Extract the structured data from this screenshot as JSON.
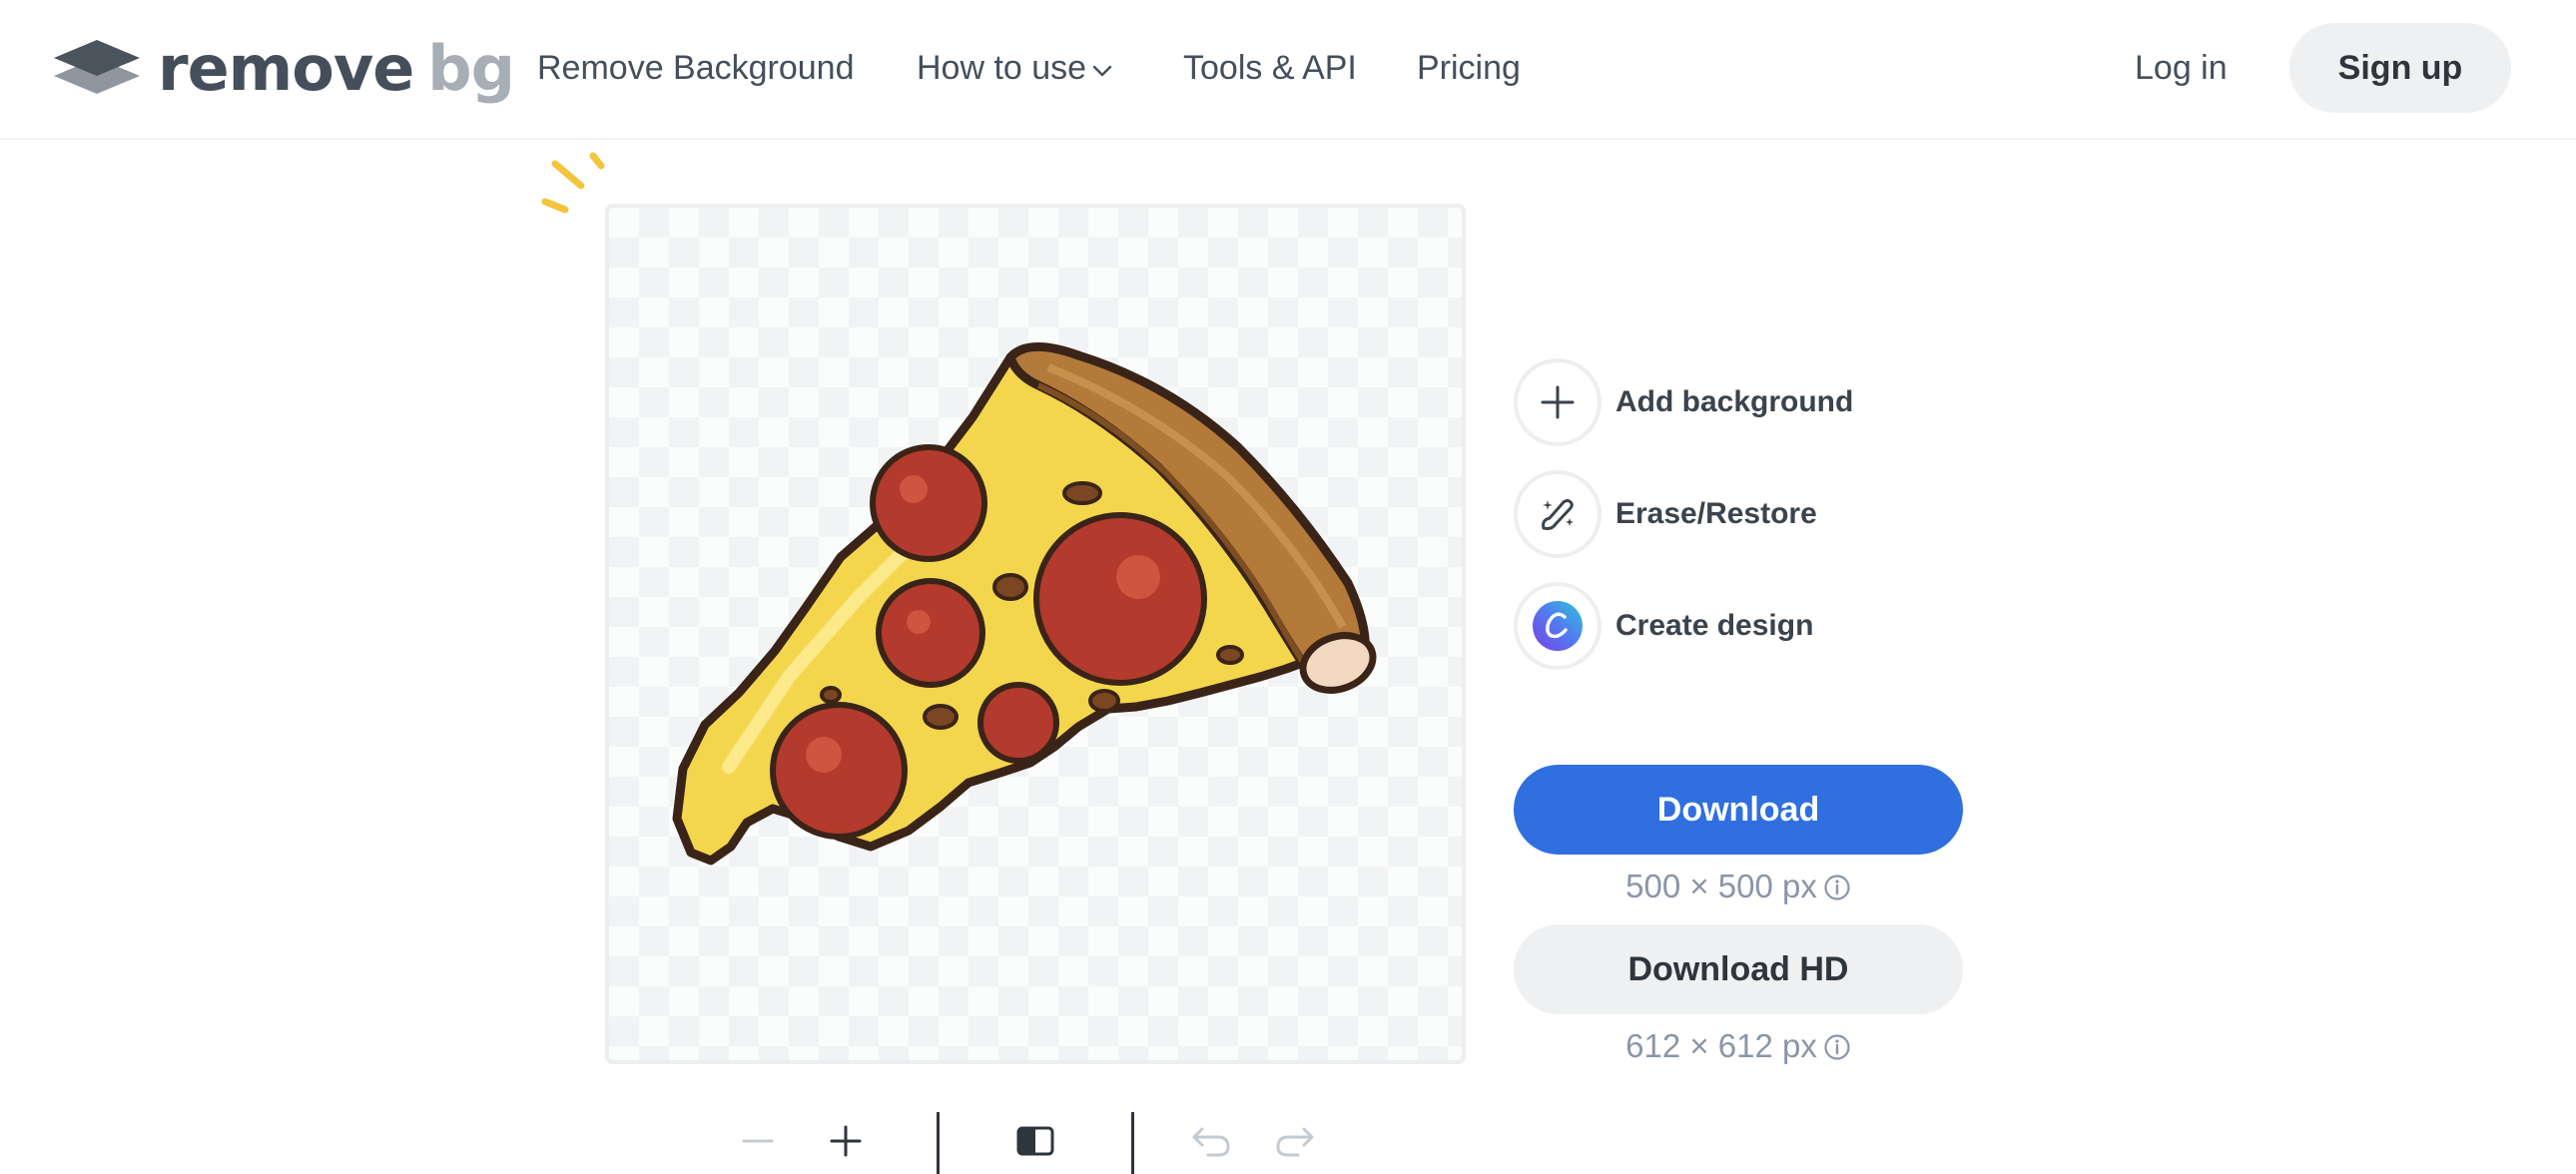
{
  "header": {
    "logo": {
      "word1": "remove",
      "word2": "bg",
      "icon": "layers-logo-icon"
    },
    "nav": [
      {
        "label": "Remove Background"
      },
      {
        "label": "How to use",
        "icon": "chevron-down-icon"
      },
      {
        "label": "Tools & API"
      },
      {
        "label": "Pricing"
      }
    ],
    "login_label": "Log in",
    "signup_label": "Sign up"
  },
  "editor": {
    "image": "pizza-slice-cutout",
    "actions": [
      {
        "label": "Add background",
        "icon": "plus-icon"
      },
      {
        "label": "Erase/Restore",
        "icon": "magic-brush-icon"
      },
      {
        "label": "Create design",
        "icon": "canva-icon"
      }
    ],
    "download": {
      "label": "Download",
      "size": "500 × 500 px"
    },
    "download_hd": {
      "label": "Download HD",
      "size": "612 × 612 px"
    }
  },
  "toolbar": {
    "tools": [
      "zoom-out-icon",
      "zoom-in-icon",
      "compare-icon",
      "undo-icon",
      "redo-icon"
    ]
  },
  "colors": {
    "primary": "#2f6fe0",
    "text": "#454f5b",
    "muted": "#8a96a8",
    "spark": "#f2c53d"
  }
}
